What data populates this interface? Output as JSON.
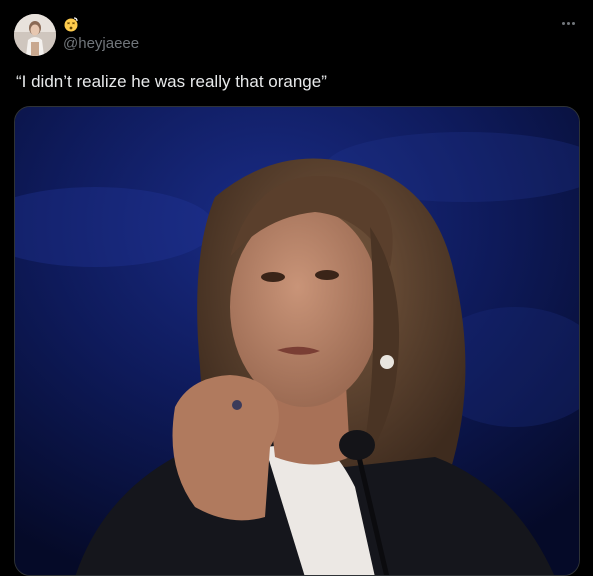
{
  "tweet": {
    "author_handle": "@heyjaeee",
    "name_emoji": "dizzy-face-emoji",
    "text": "“I didn’t realize he was really that orange”",
    "more_icon": "more-horizontal-icon"
  },
  "colors": {
    "background": "#000000",
    "text_primary": "#e7e9ea",
    "text_secondary": "#71767b",
    "media_border": "#2f3336"
  }
}
